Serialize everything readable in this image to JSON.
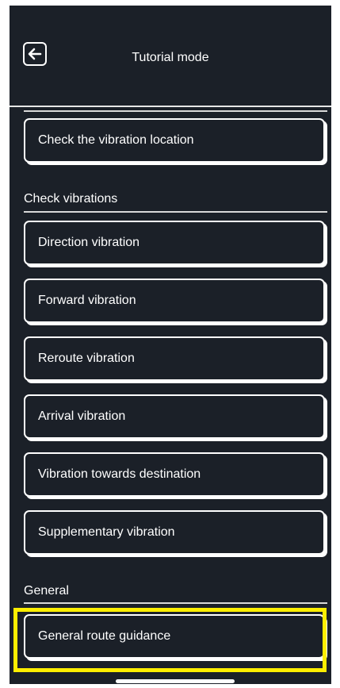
{
  "header": {
    "title": "Tutorial mode",
    "back_icon": "arrow-left-icon"
  },
  "list": {
    "top_item": "Check the vibration location",
    "sections": [
      {
        "label": "Check vibrations",
        "items": [
          "Direction vibration",
          "Forward vibration",
          "Reroute vibration",
          "Arrival vibration",
          "Vibration towards destination",
          "Supplementary vibration"
        ]
      },
      {
        "label": "General",
        "items": [
          "General route guidance"
        ]
      }
    ]
  },
  "colors": {
    "background": "#1b2028",
    "text": "#ffffff",
    "highlight": "#ffee00"
  }
}
